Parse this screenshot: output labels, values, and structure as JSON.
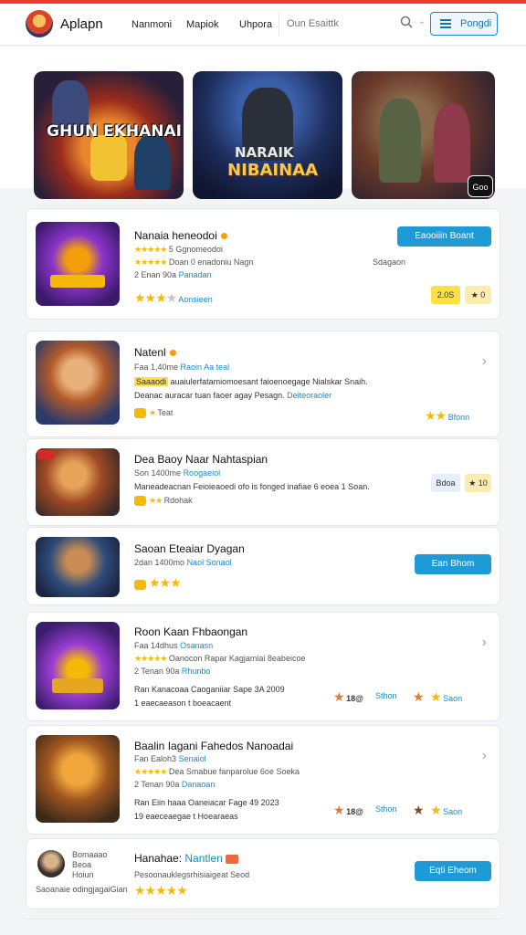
{
  "header": {
    "brand": "Aplapn",
    "nav": [
      "Nanmoni",
      "Mapiok",
      "Uhpora"
    ],
    "search_placeholder": "Oun Esaittk",
    "button_label": "Pongdi"
  },
  "banners": [
    {
      "text": "GHUN EKHANAI"
    },
    {
      "text_top": "NARAIK",
      "text_main": "NIBAINAA"
    },
    {
      "badge": "Goo"
    }
  ],
  "cards": [
    {
      "title": "Nanaia heneodoi",
      "line1": "★★★★★ 5 Ggnomeodoi",
      "line1_stars": "★★★★★",
      "line1_text": "5 Ggnomeodoi",
      "line2_prefix": "★★★★★",
      "line2_text": "Doan 0 enadoniu Nagn",
      "line2_right": "Sdagaon",
      "line3_text": "2 Enan 90a",
      "line3_link": "Panadan",
      "rating_link": "Aonsieen",
      "button": "Eaooiiin Boant",
      "pill1": "2.0S",
      "pill2": "0"
    },
    {
      "title": "Natenl",
      "meta": "Faa 1,40me",
      "meta_link": "Raoin Aa teal",
      "desc1_hl": "Saaaodi",
      "desc1": "auaiulerfatamiomoesant faioenoegage Nialskar Snaih.",
      "desc2": "Deanac auracar tuan faoer agay Pesagn.",
      "desc2_link": "Deiteoraoler",
      "badge_text": "Teat",
      "right_link": "Bfonn"
    },
    {
      "title": "Dea Baoy Naar Nahtaspian",
      "meta": "Son 1400me",
      "meta_link": "Roogaeiol",
      "desc": "Maneadeacnan Feioieaoedi ofo is fonged inafiae 6 eoea 1 Soan.",
      "badge_text": "Rdohak",
      "pill1": "Bdoa",
      "pill2": "10"
    },
    {
      "title": "Saoan Eteaiar Dyagan",
      "meta": "2dan 1400mo",
      "meta_link": "Naol Sonaol",
      "button": "Ean Bhom"
    },
    {
      "title": "Roon Kaan Fhbaongan",
      "meta": "Faa 14dhus",
      "meta_link": "Osanasn",
      "line1_stars": "★★★★★",
      "line1_text": "Oanocon Rapar Kagjamiai 8eabeicoe",
      "line2_text": "2 Tenan 90a",
      "line2_link": "Rhunbo",
      "desc1": "Ran Kanacoaa Caoganiiar Sape 3A 2009",
      "desc2": "1 eaecaeason t boeacaent",
      "stat1": "18@",
      "stat2_link": "Sthon",
      "stat3_link": "Saon"
    },
    {
      "title": "Baalin Iagani Fahedos Nanoadai",
      "meta": "Fan Ealoh3",
      "meta_link": "Senaiol",
      "line1_stars": "★★★★★",
      "line1_text": "Dea Smabue fanparolue 6oe Soeka",
      "line2_text": "2 Tenan 90a",
      "line2_link": "Danaoan",
      "desc1": "Ran Eiin haaa Oaneiacar Fage 49 2023",
      "desc2": "19 eaeceaegae t Hoearaeas",
      "stat1": "18@",
      "stat2_link": "Sthon",
      "stat3_link": "Saon"
    },
    {
      "avatar_caption1": "Bomaaao",
      "avatar_caption2": "Beoa",
      "avatar_caption3": "Hoiun",
      "footer_text": "Saoanaie odingjagaiGian",
      "title": "Hanahae:",
      "title_link": "Nantlen",
      "meta": "Pesoonauklegsrhisiaigeat Seod",
      "button": "Eqti Eheom"
    }
  ]
}
